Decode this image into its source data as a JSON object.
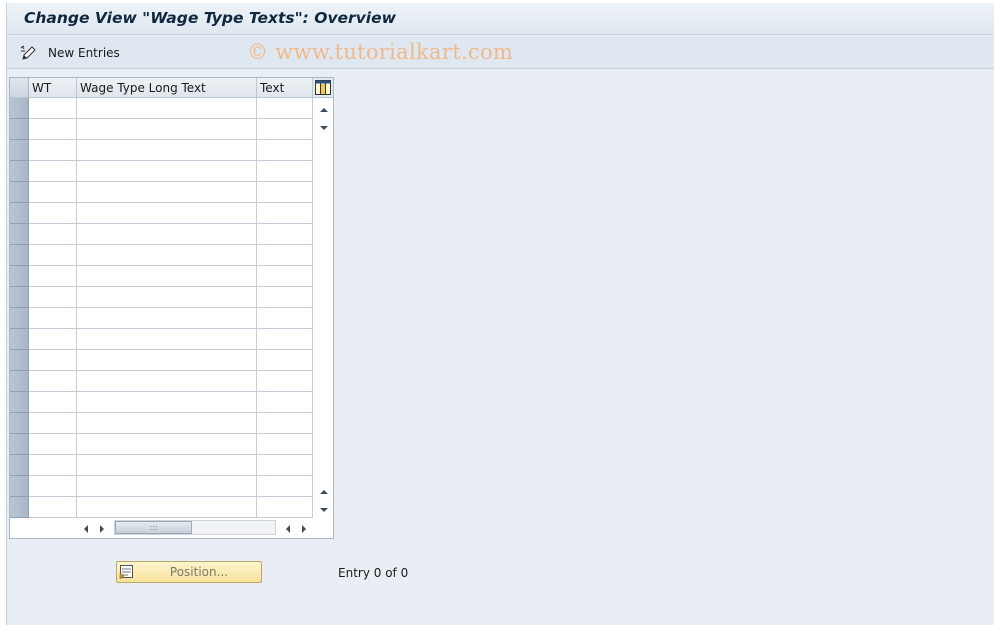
{
  "window": {
    "title": "Change View \"Wage Type Texts\": Overview"
  },
  "toolbar": {
    "new_entries_label": "New Entries",
    "new_entries_icon": "pencil-new-icon"
  },
  "watermark": "© www.tutorialkart.com",
  "table": {
    "columns": [
      "WT",
      "Wage Type Long Text",
      "Text"
    ],
    "visible_rows": 20,
    "rows": []
  },
  "footer": {
    "position_button_label": "Position...",
    "entry_status": "Entry 0 of 0"
  },
  "colors": {
    "background": "#e9eef4",
    "watermark": "#f0b98c",
    "position_button": "#f6e29a"
  }
}
